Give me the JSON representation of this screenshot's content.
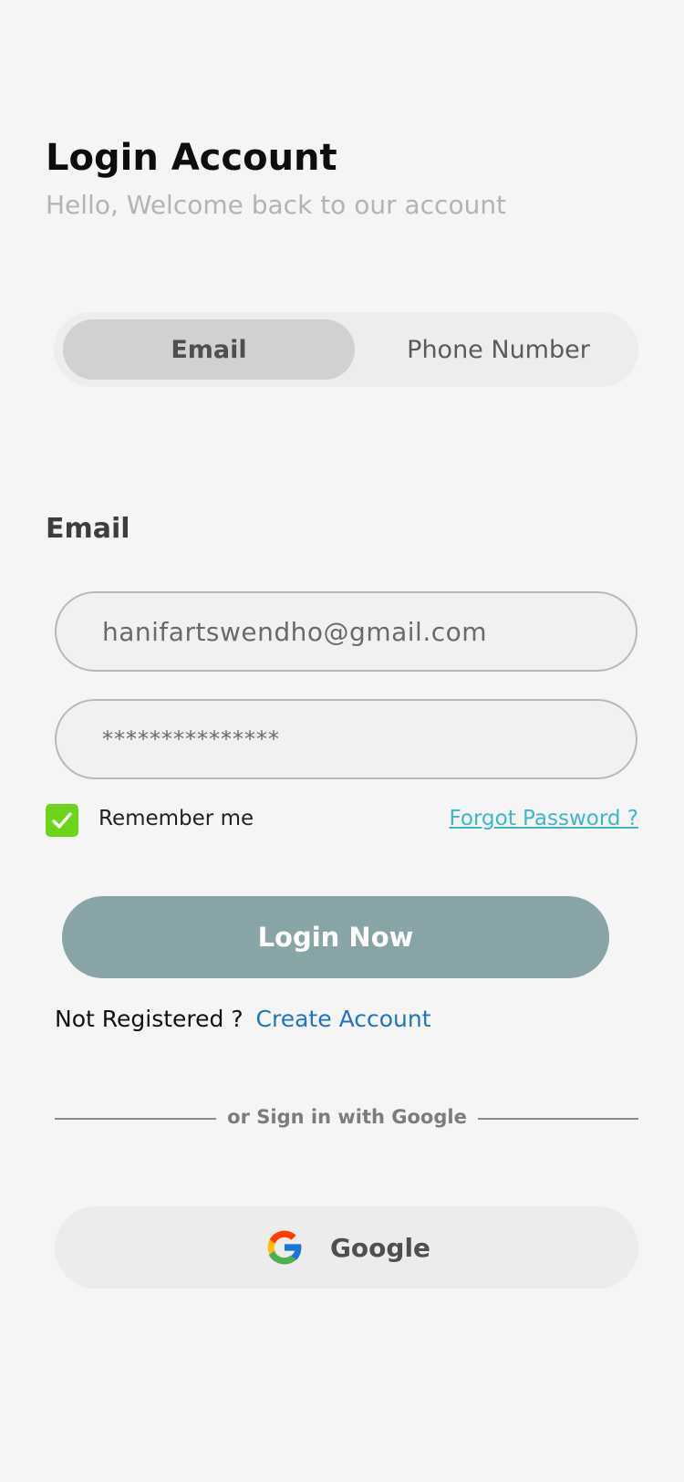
{
  "header": {
    "title": "Login Account",
    "subtitle": "Hello, Welcome back to our account"
  },
  "login_method_tabs": {
    "active": "Email",
    "inactive": "Phone Number"
  },
  "form": {
    "email_label": "Email",
    "email_value": "hanifartswendho@gmail.com",
    "password_value": "***************",
    "remember_me_label": "Remember me",
    "remember_me_checked": true,
    "forgot_password_label": "Forgot Password ?"
  },
  "actions": {
    "login_label": "Login Now",
    "not_registered_text": "Not Registered ?",
    "create_account_label": "Create Account",
    "divider_text": "or Sign in with Google",
    "google_label": "Google",
    "google_icon": "google-icon"
  },
  "colors": {
    "background": "#f5f5f5",
    "checkbox": "#6cd419",
    "login_button": "#88a4a6",
    "forgot_link": "#3fb7c9",
    "create_link": "#1f73c9"
  }
}
